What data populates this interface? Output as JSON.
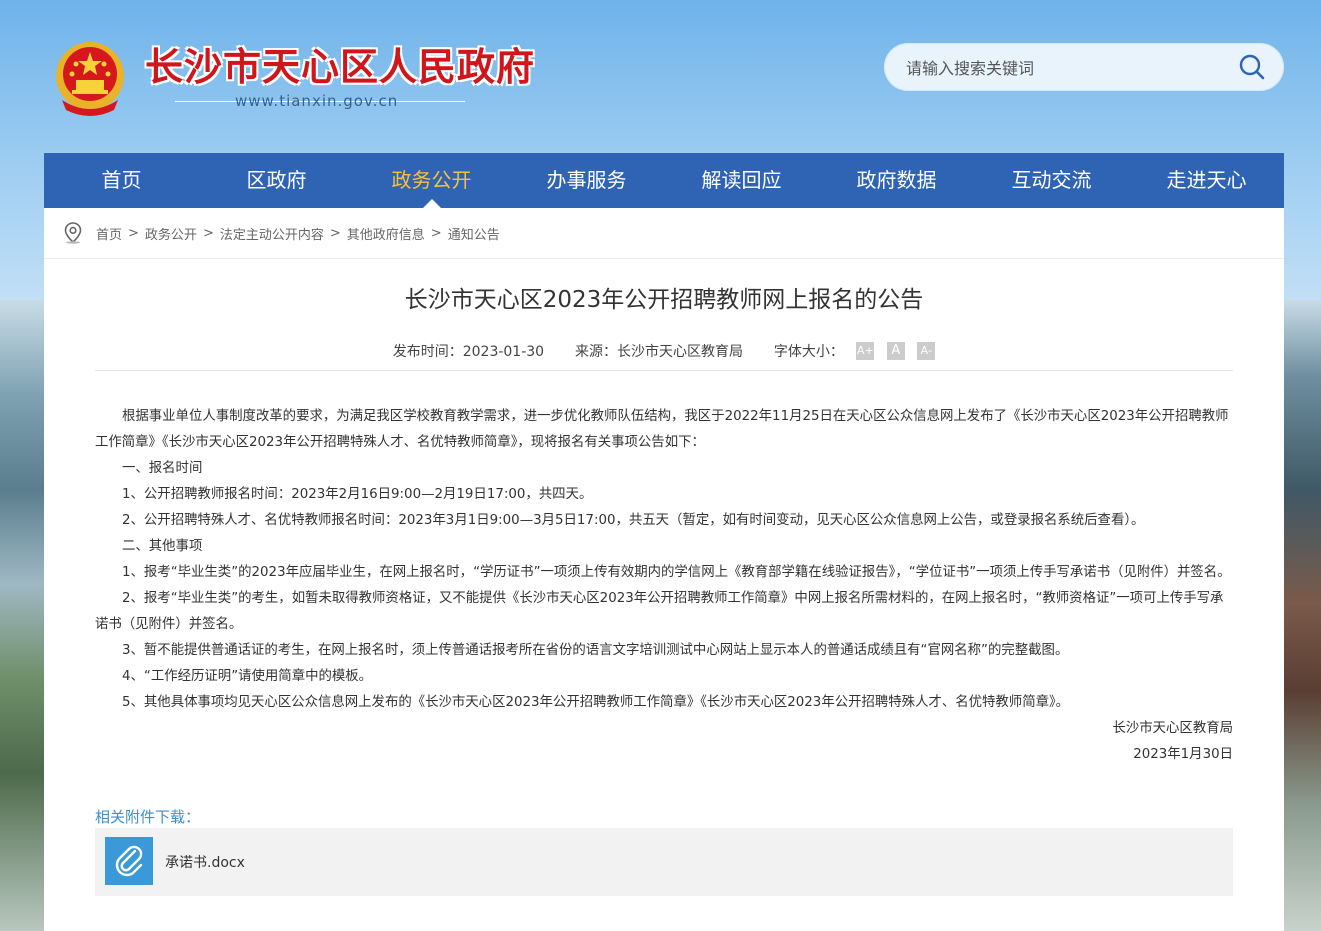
{
  "header": {
    "site_title": "长沙市天心区人民政府",
    "site_url": "www.tianxin.gov.cn",
    "search_placeholder": "请输入搜索关键词"
  },
  "nav": {
    "items": [
      "首页",
      "区政府",
      "政务公开",
      "办事服务",
      "解读回应",
      "政府数据",
      "互动交流",
      "走进天心"
    ],
    "active_index": 2
  },
  "breadcrumb": [
    "首页",
    "政务公开",
    "法定主动公开内容",
    "其他政府信息",
    "通知公告"
  ],
  "article": {
    "title": "长沙市天心区2023年公开招聘教师网上报名的公告",
    "publish_label": "发布时间：2023-01-30",
    "source_label": "来源：长沙市天心区教育局",
    "font_size_label": "字体大小：",
    "font_buttons": [
      "A+",
      "A",
      "A-"
    ],
    "paragraphs": [
      "根据事业单位人事制度改革的要求，为满足我区学校教育教学需求，进一步优化教师队伍结构，我区于2022年11月25日在天心区公众信息网上发布了《长沙市天心区2023年公开招聘教师工作简章》《长沙市天心区2023年公开招聘特殊人才、名优特教师简章》，现将报名有关事项公告如下：",
      "一、报名时间",
      "1、公开招聘教师报名时间：2023年2月16日9:00—2月19日17:00，共四天。",
      "2、公开招聘特殊人才、名优特教师报名时间：2023年3月1日9:00—3月5日17:00，共五天（暂定，如有时间变动，见天心区公众信息网上公告，或登录报名系统后查看）。",
      "二、其他事项",
      "1、报考“毕业生类”的2023年应届毕业生，在网上报名时，“学历证书”一项须上传有效期内的学信网上《教育部学籍在线验证报告》，“学位证书”一项须上传手写承诺书（见附件）并签名。",
      "2、报考“毕业生类”的考生，如暂未取得教师资格证，又不能提供《长沙市天心区2023年公开招聘教师工作简章》中网上报名所需材料的，在网上报名时，“教师资格证”一项可上传手写承诺书（见附件）并签名。",
      "3、暂不能提供普通话证的考生，在网上报名时，须上传普通话报考所在省份的语言文字培训测试中心网站上显示本人的普通话成绩且有“官网名称”的完整截图。",
      "4、“工作经历证明”请使用简章中的模板。",
      "5、其他具体事项均见天心区公众信息网上发布的《长沙市天心区2023年公开招聘教师工作简章》《长沙市天心区2023年公开招聘特殊人才、名优特教师简章》。"
    ],
    "signature": "长沙市天心区教育局",
    "date": "2023年1月30日"
  },
  "attachments": {
    "label": "相关附件下载：",
    "files": [
      "承诺书.docx"
    ]
  },
  "colors": {
    "nav_bg": "#2f64b4",
    "nav_active": "#f5c33b",
    "title_red": "#d0161b",
    "attach_blue": "#3a8fd1"
  }
}
